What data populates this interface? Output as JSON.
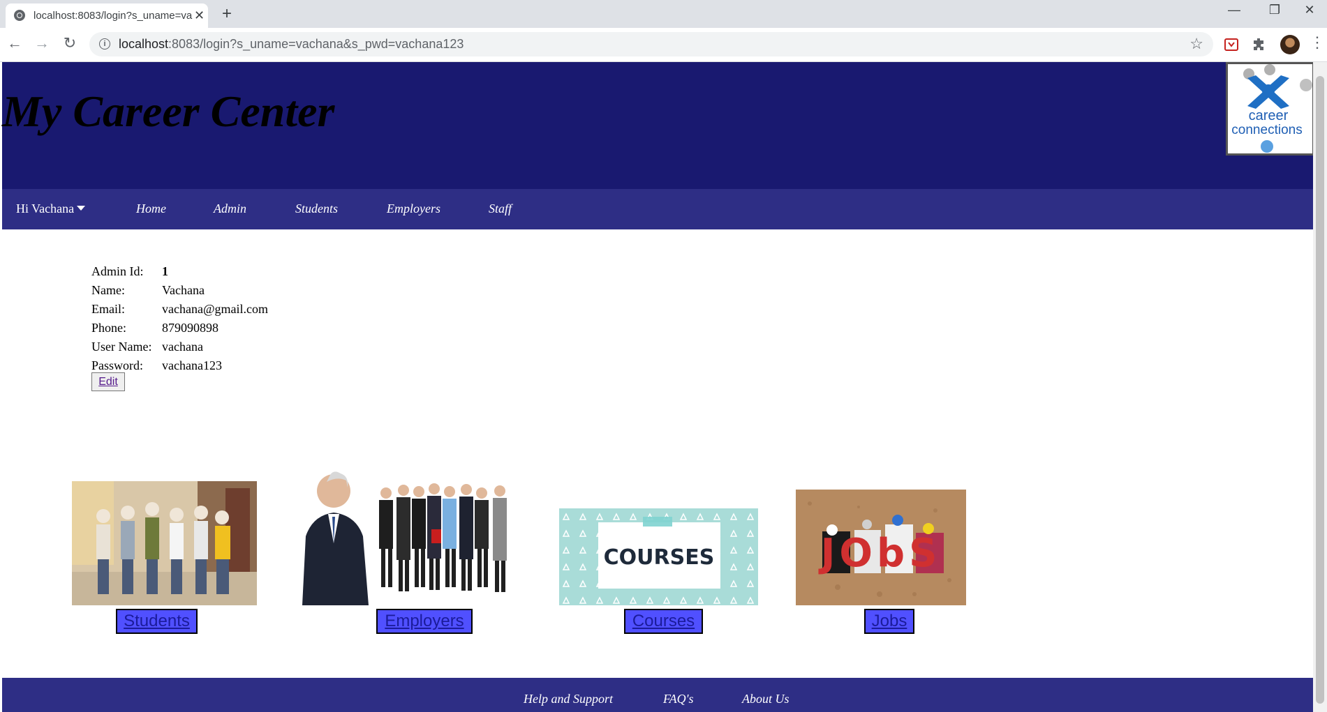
{
  "browser": {
    "tab_title": "localhost:8083/login?s_uname=vachana&s_pwd=vachana123",
    "url_host": "localhost",
    "url_rest": ":8083/login?s_uname=vachana&s_pwd=vachana123",
    "icons": [
      "globe-icon",
      "close-icon",
      "plus-icon",
      "back-icon",
      "forward-icon",
      "reload-icon",
      "info-icon",
      "star-icon",
      "extension-icon",
      "puzzle-icon",
      "avatar",
      "kebab-icon"
    ]
  },
  "header": {
    "title": "My Career Center",
    "logo_text_1": "career",
    "logo_text_2": "connections"
  },
  "nav": {
    "user_label": "Hi Vachana",
    "items": [
      "Home",
      "Admin",
      "Students",
      "Employers",
      "Staff"
    ]
  },
  "profile": {
    "fields": [
      {
        "label": "Admin Id:",
        "value": "1"
      },
      {
        "label": "Name:",
        "value": "Vachana"
      },
      {
        "label": "Email:",
        "value": "vachana@gmail.com"
      },
      {
        "label": "Phone:",
        "value": "879090898"
      },
      {
        "label": "User Name:",
        "value": "vachana"
      },
      {
        "label": "Password:",
        "value": "vachana123"
      }
    ],
    "edit_label": "Edit"
  },
  "cards": [
    {
      "label": "Students",
      "image_text": ""
    },
    {
      "label": "Employers",
      "image_text": ""
    },
    {
      "label": "Courses",
      "image_text": "COURSES"
    },
    {
      "label": "Jobs",
      "image_text": "JObS"
    }
  ],
  "footer": {
    "items": [
      "Help and Support",
      "FAQ's",
      "About Us"
    ]
  },
  "colors": {
    "header_bg": "#191970",
    "nav_bg": "#2e2e85",
    "card_link_bg": "#5050ff"
  }
}
